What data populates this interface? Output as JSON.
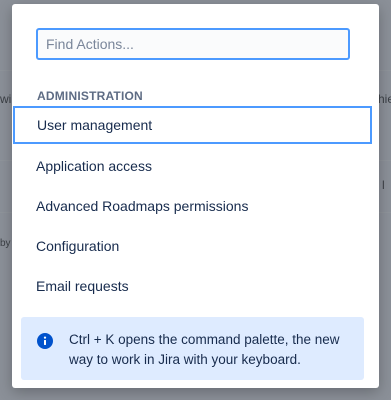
{
  "background": {
    "fragments": [
      "wi",
      "hie",
      "by",
      "l"
    ]
  },
  "dialog": {
    "search": {
      "placeholder": "Find Actions...",
      "value": ""
    },
    "section_heading": "ADMINISTRATION",
    "items": [
      {
        "label": "User management",
        "selected": true
      },
      {
        "label": "Application access",
        "selected": false
      },
      {
        "label": "Advanced Roadmaps permissions",
        "selected": false
      },
      {
        "label": "Configuration",
        "selected": false
      },
      {
        "label": "Email requests",
        "selected": false
      }
    ],
    "info": {
      "icon": "info-icon",
      "text": "Ctrl + K opens the command palette, the new way to work in Jira with your keyboard."
    }
  },
  "colors": {
    "focus": "#4c9aff",
    "info_bg": "#deebff",
    "info_icon": "#0052cc",
    "text": "#172b4d",
    "heading": "#5e6c84"
  }
}
